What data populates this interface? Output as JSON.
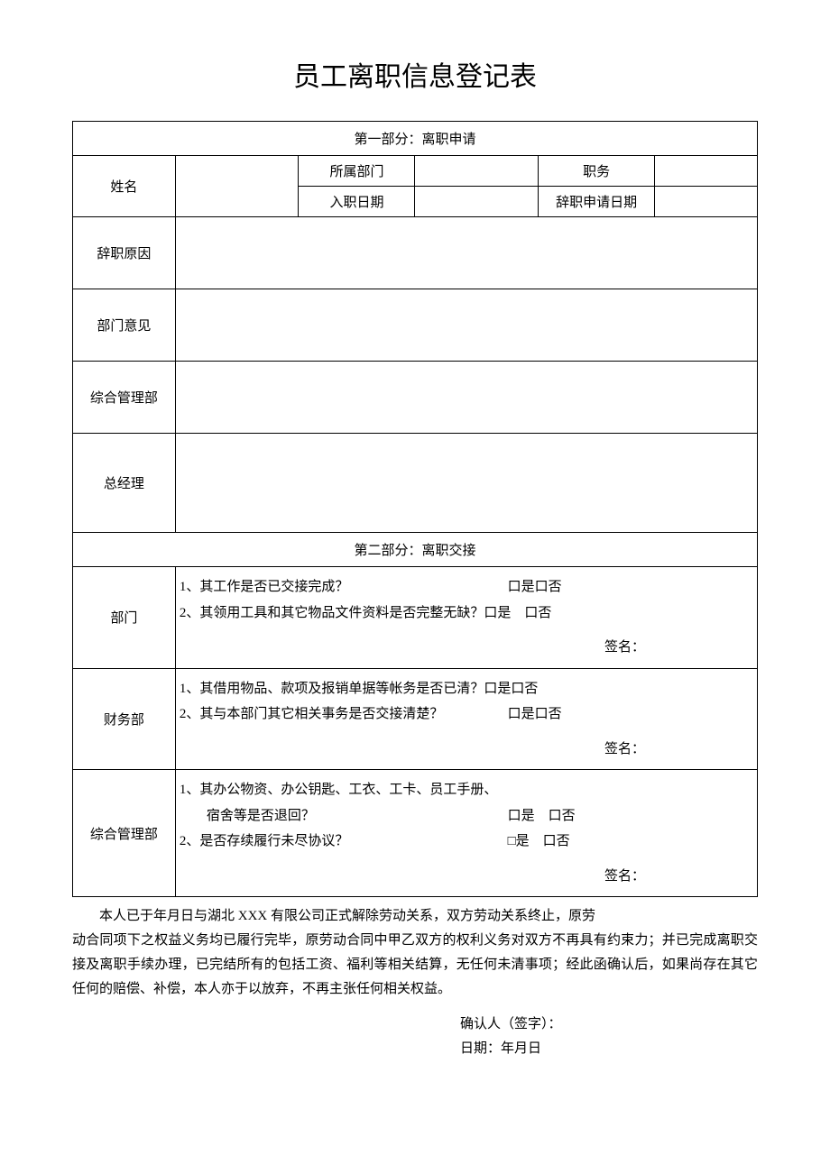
{
  "title": "员工离职信息登记表",
  "section1": {
    "header": "第一部分：离职申请",
    "labels": {
      "name": "姓名",
      "department": "所属部门",
      "position": "职务",
      "entryDate": "入职日期",
      "resignDate": "辞职申请日期",
      "resignReason": "辞职原因",
      "deptOpinion": "部门意见",
      "genMgmt": "综合管理部",
      "gm": "总经理"
    }
  },
  "section2": {
    "header": "第二部分：离职交接",
    "dept": {
      "label": "部门",
      "item1": "1、其工作是否已交接完成？",
      "item1opts": "口是口否",
      "item2": "2、其领用工具和其它物品文件资料是否完整无缺？口是　口否",
      "sign": "签名："
    },
    "finance": {
      "label": "财务部",
      "item1": "1、其借用物品、款项及报销单据等帐务是否已清？口是口否",
      "item2": "2、其与本部门其它相关事务是否交接清楚？",
      "item2opts": "口是口否",
      "sign": "签名："
    },
    "genMgmt": {
      "label": "综合管理部",
      "item1a": "1、其办公物资、办公钥匙、工衣、工卡、员工手册、",
      "item1b": "　　宿舍等是否退回？",
      "item1opts": "口是　口否",
      "item2": "2、是否存续履行未尽协议？",
      "item2opts": "□是　口否",
      "sign": "签名："
    }
  },
  "declaration": {
    "line1": "本人已于年月日与湖北 XXX 有限公司正式解除劳动关系，双方劳动关系终止，原劳",
    "line2": "动合同项下之权益义务均已履行完毕，原劳动合同中甲乙双方的权利义务对双方不再具有约束力；并已完成离职交接及离职手续办理，已完结所有的包括工资、福利等相关结算，无任何未清事项；经此函确认后，如果尚存在其它任何的赔偿、补偿，本人亦于以放弃，不再主张任何相关权益。"
  },
  "footer": {
    "confirm": "确认人（签字）：",
    "date": "日期：年月日"
  }
}
